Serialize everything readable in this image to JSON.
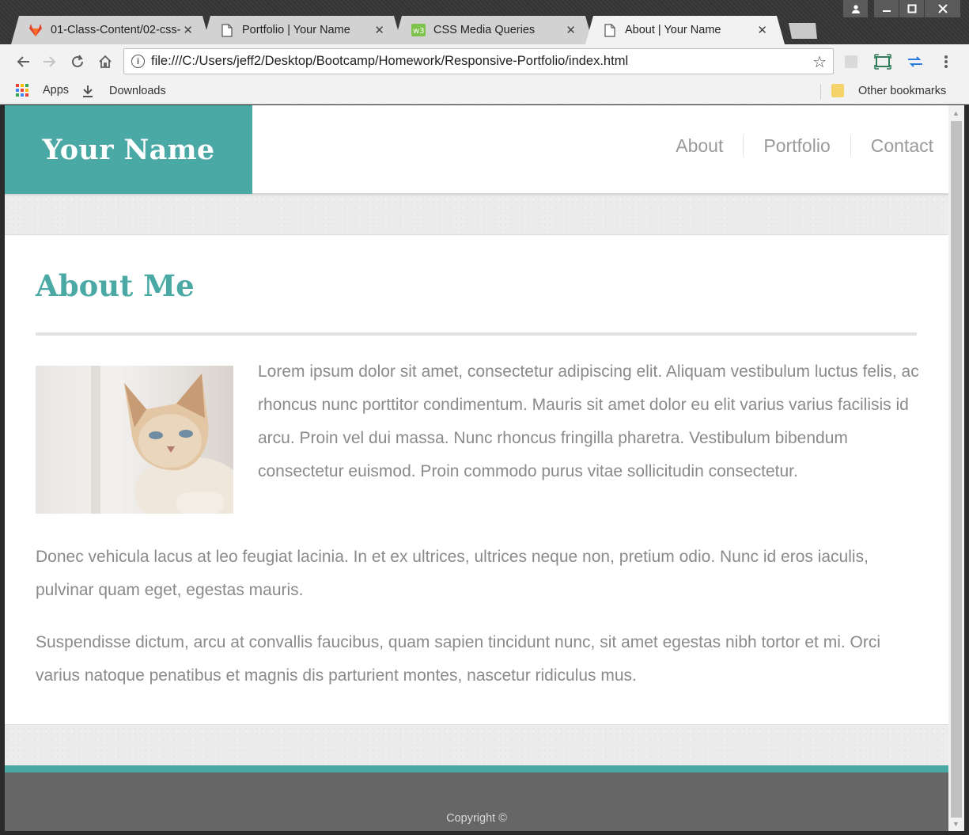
{
  "browser": {
    "tabs": [
      {
        "title": "01-Class-Content/02-css-",
        "icon": "gitlab-icon",
        "active": false
      },
      {
        "title": "Portfolio | Your Name",
        "icon": "page-icon",
        "active": false
      },
      {
        "title": "CSS Media Queries",
        "icon": "w3-icon",
        "active": false
      },
      {
        "title": "About | Your Name",
        "icon": "page-icon",
        "active": true
      }
    ],
    "close_glyph": "✕",
    "url": "file:///C:/Users/jeff2/Desktop/Bootcamp/Homework/Responsive-Portfolio/index.html",
    "bookmarks": {
      "apps": "Apps",
      "downloads": "Downloads",
      "other": "Other bookmarks"
    }
  },
  "site": {
    "brand": "Your Name",
    "nav": [
      "About",
      "Portfolio",
      "Contact"
    ],
    "heading": "About Me",
    "paragraphs": [
      "Lorem ipsum dolor sit amet, consectetur adipiscing elit. Aliquam vestibulum luctus felis, ac rhoncus nunc porttitor condimentum. Mauris sit amet dolor eu elit varius varius facilisis id arcu. Proin vel dui massa. Nunc rhoncus fringilla pharetra. Vestibulum bibendum consectetur euismod. Proin commodo purus vitae sollicitudin consectetur.",
      "Donec vehicula lacus at leo feugiat lacinia. In et ex ultrices, ultrices neque non, pretium odio. Nunc id eros iaculis, pulvinar quam eget, egestas mauris.",
      "Suspendisse dictum, arcu at convallis faucibus, quam sapien tincidunt nunc, sit amet egestas nibh tortor et mi. Orci varius natoque penatibus et magnis dis parturient montes, nascetur ridiculus mus."
    ],
    "footer": "Copyright ©"
  },
  "colors": {
    "accent": "#4aa8a5",
    "text": "#8a8a8a",
    "footer": "#666666"
  }
}
